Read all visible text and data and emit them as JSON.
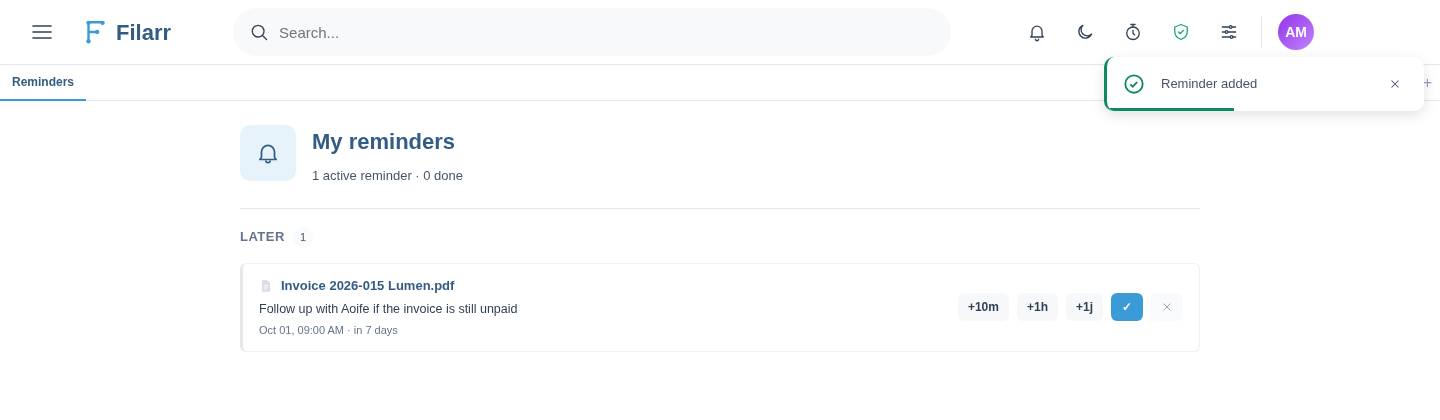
{
  "app": {
    "name": "Filarr"
  },
  "search": {
    "placeholder": "Search..."
  },
  "user": {
    "initials": "AM"
  },
  "tabs": [
    {
      "label": "Reminders",
      "selected": true
    }
  ],
  "tab_add": "+",
  "header": {
    "title": "My reminders",
    "subtitle": "1 active reminder · 0 done"
  },
  "groups": [
    {
      "label": "LATER",
      "count": "1",
      "items": [
        {
          "file": "Invoice 2026-015 Lumen.pdf",
          "note": "Follow up with Aoife if the invoice is still unpaid",
          "when": "Oct 01, 09:00 AM · in 7 days",
          "actions": [
            {
              "label": "+10m",
              "kind": "snooze"
            },
            {
              "label": "+1h",
              "kind": "snooze"
            },
            {
              "label": "+1j",
              "kind": "snooze"
            },
            {
              "label": "✓",
              "kind": "done"
            },
            {
              "kind": "dismiss"
            }
          ]
        }
      ]
    }
  ],
  "toast": {
    "message": "Reminder added",
    "level": 0.4
  }
}
